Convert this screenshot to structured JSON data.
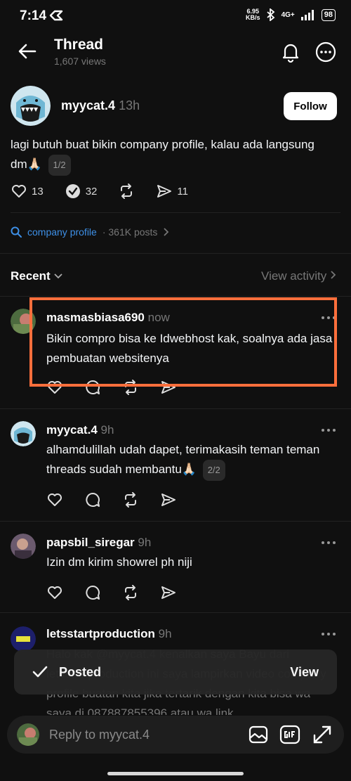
{
  "status_bar": {
    "time": "7:14",
    "net_speed": "6.95",
    "net_unit": "KB/s",
    "network": "4G+",
    "battery": "98"
  },
  "header": {
    "title": "Thread",
    "views": "1,607 views"
  },
  "op": {
    "username": "myycat.4",
    "time": "13h",
    "follow_label": "Follow",
    "text": "lagi butuh buat bikin company profile, kalau ada langsung dm🙏🏻",
    "page_badge": "1/2",
    "likes": "13",
    "replies": "32",
    "reposts": "",
    "shares": "11"
  },
  "topic": {
    "name": "company profile",
    "meta": "· 361K posts"
  },
  "sort": {
    "label": "Recent",
    "view_activity": "View activity"
  },
  "replies": [
    {
      "username": "masmasbiasa690",
      "time": "now",
      "text": "Bikin compro bisa ke Idwebhost kak, soalnya ada jasa pembuatan websitenya"
    },
    {
      "username": "myycat.4",
      "time": "9h",
      "text": "alhamdulillah udah dapet, terimakasih teman teman threads sudah membantu🙏🏻",
      "badge": "2/2"
    },
    {
      "username": "papsbil_siregar",
      "time": "9h",
      "text": "Izin dm kirim showrel ph niji"
    },
    {
      "username": "letsstartproduction",
      "time": "9h",
      "text": "Halo kak @myycat.4 kenalkan saya Bayu dari letsstartproduction ini saya lampirkan video company profile buatan kita jika tertarik dengan kita bisa wa saya di 087887855396 atau wa link"
    }
  ],
  "toast": {
    "label": "Posted",
    "action": "View"
  },
  "reply_bar": {
    "placeholder": "Reply to myycat.4"
  },
  "colors": {
    "background": "#101010",
    "accent_link": "#3d8fe6",
    "highlight": "#ff6f3c"
  }
}
